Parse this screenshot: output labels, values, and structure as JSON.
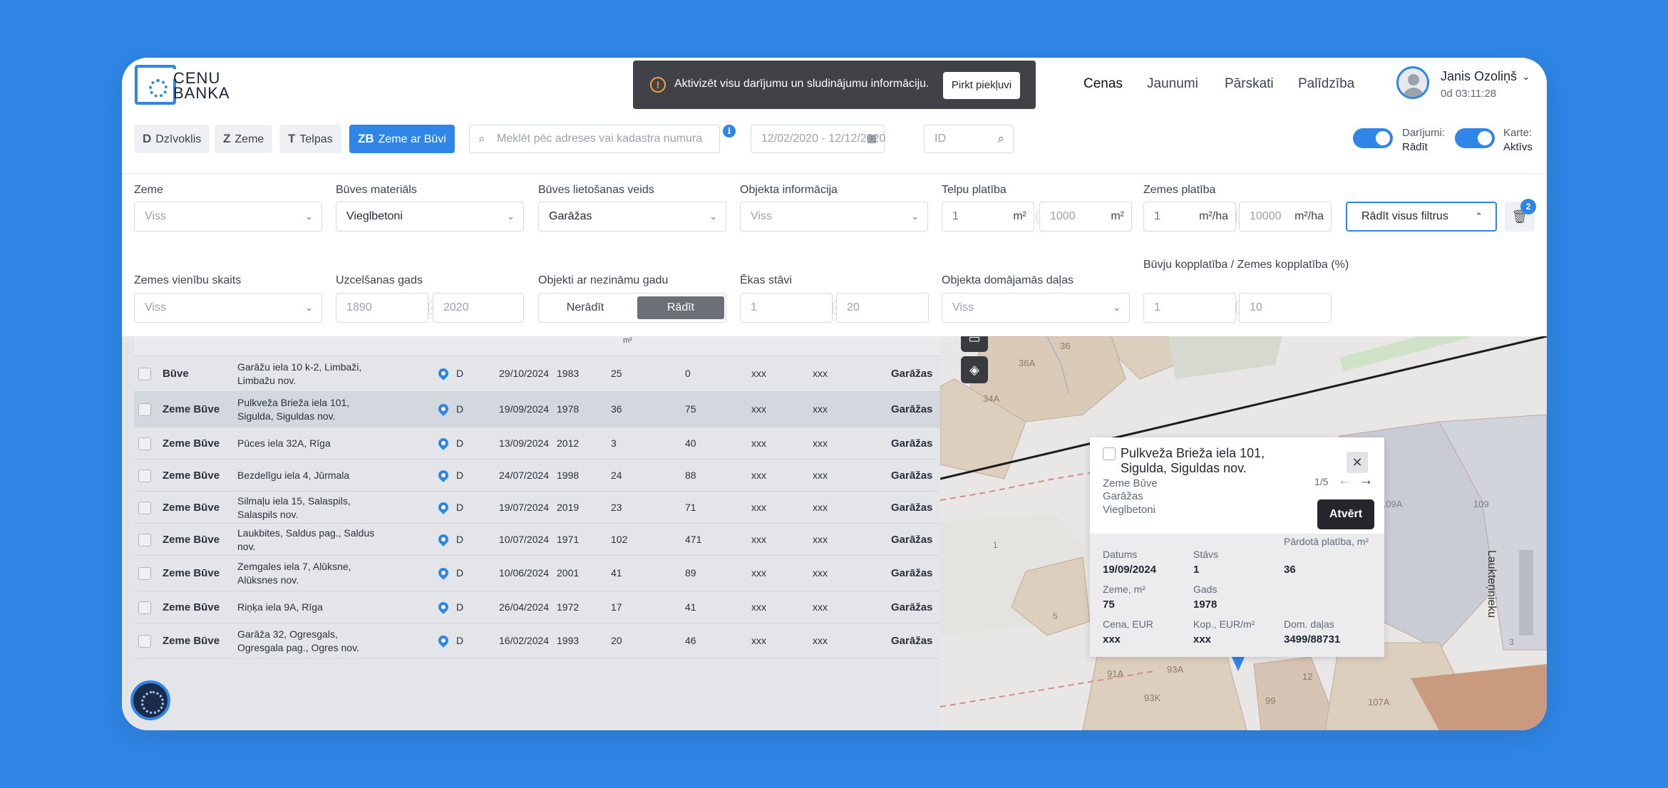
{
  "app": {
    "logo_text": "CENU\nBANKA"
  },
  "banner": {
    "message": "Aktivizēt visu darījumu un sludinājumu informāciju.",
    "button": "Pirkt piekļuvi"
  },
  "nav": [
    {
      "label": "Cenas",
      "active": true
    },
    {
      "label": "Jaunumi",
      "active": false
    },
    {
      "label": "Pārskati",
      "active": false
    },
    {
      "label": "Palīdzība",
      "active": false
    }
  ],
  "user": {
    "name": "Janis Ozoliņš",
    "time": "0d 03:11:28"
  },
  "tabs": [
    {
      "letter": "D",
      "label": "Dzīvoklis"
    },
    {
      "letter": "Z",
      "label": "Zeme"
    },
    {
      "letter": "T",
      "label": "Telpas"
    },
    {
      "letter": "ZB",
      "label": "Zeme ar Būvi"
    }
  ],
  "search": {
    "placeholder": "Meklēt pēc adreses vai kadastra numura",
    "info": "i",
    "date_range": "12/02/2020 - 12/12/2020",
    "id_placeholder": "ID"
  },
  "toggles": {
    "deals_label": "Darījumi:",
    "deals_value": "Rādīt",
    "map_label": "Karte:",
    "map_value": "Aktīvs"
  },
  "filters": {
    "zeme": {
      "label": "Zeme",
      "value": "Viss"
    },
    "material": {
      "label": "Būves materiāls",
      "value": "Vieglbetoni"
    },
    "usage": {
      "label": "Būves lietošanas veids",
      "value": "Garāžas"
    },
    "objinfo": {
      "label": "Objekta informācija",
      "value": "Viss"
    },
    "area": {
      "label": "Telpu platība",
      "from": "1",
      "to": "1000",
      "unit": "m²"
    },
    "land": {
      "label": "Zemes platība",
      "from": "1",
      "to": "10000",
      "unit": "m²/ha"
    },
    "units": {
      "label": "Zemes vienību skaits",
      "value": "Viss"
    },
    "year": {
      "label": "Uzcelšanas gads",
      "from": "1890",
      "to": "2020"
    },
    "unknown": {
      "label": "Objekti ar nezināmu gadu",
      "off": "Nerādīt",
      "on": "Rādīt"
    },
    "floors": {
      "label": "Ēkas stāvi",
      "from": "1",
      "to": "20"
    },
    "shares": {
      "label": "Objekta domājamās daļas",
      "value": "Viss"
    },
    "ratio": {
      "label": "Būvju kopplatība / Zemes kopplatība (%)",
      "from": "1",
      "to": "10"
    },
    "show_all": "Rādīt visus filtrus",
    "count": "2",
    "dash": "–"
  },
  "table": {
    "unit_header": "m²",
    "rows": [
      {
        "type": "Būve",
        "addr": "Garāžu iela 10 k-2, Limbaži, Limbažu nov.",
        "src": "D",
        "date": "29/10/2024",
        "year": "1983",
        "area": "25",
        "land": "0",
        "price": "xxx",
        "ppm": "xxx",
        "use": "Garāžas"
      },
      {
        "type": "Zeme Būve",
        "addr": "Pulkveža Brieža iela 101, Sigulda, Siguldas nov.",
        "src": "D",
        "date": "19/09/2024",
        "year": "1978",
        "area": "36",
        "land": "75",
        "price": "xxx",
        "ppm": "xxx",
        "use": "Garāžas"
      },
      {
        "type": "Zeme Būve",
        "addr": "Pūces iela 32A, Rīga",
        "src": "D",
        "date": "13/09/2024",
        "year": "2012",
        "area": "3",
        "land": "40",
        "price": "xxx",
        "ppm": "xxx",
        "use": "Garāžas"
      },
      {
        "type": "Zeme Būve",
        "addr": "Bezdelīgu iela 4, Jūrmala",
        "src": "D",
        "date": "24/07/2024",
        "year": "1998",
        "area": "24",
        "land": "88",
        "price": "xxx",
        "ppm": "xxx",
        "use": "Garāžas"
      },
      {
        "type": "Zeme Būve",
        "addr": "Silmaļu iela 15, Salaspils, Salaspils nov.",
        "src": "D",
        "date": "19/07/2024",
        "year": "2019",
        "area": "23",
        "land": "71",
        "price": "xxx",
        "ppm": "xxx",
        "use": "Garāžas"
      },
      {
        "type": "Zeme Būve",
        "addr": "Laukbites, Saldus pag., Saldus nov.",
        "src": "D",
        "date": "10/07/2024",
        "year": "1971",
        "area": "102",
        "land": "471",
        "price": "xxx",
        "ppm": "xxx",
        "use": "Garāžas"
      },
      {
        "type": "Zeme Būve",
        "addr": "Zemgales iela 7, Alūksne, Alūksnes nov.",
        "src": "D",
        "date": "10/06/2024",
        "year": "2001",
        "area": "41",
        "land": "89",
        "price": "xxx",
        "ppm": "xxx",
        "use": "Garāžas"
      },
      {
        "type": "Zeme Būve",
        "addr": "Riņķa iela 9A, Rīga",
        "src": "D",
        "date": "26/04/2024",
        "year": "1972",
        "area": "17",
        "land": "41",
        "price": "xxx",
        "ppm": "xxx",
        "use": "Garāžas"
      },
      {
        "type": "Zeme Būve",
        "addr": "Garāža 32, Ogresgals, Ogresgala pag., Ogres nov.",
        "src": "D",
        "date": "16/02/2024",
        "year": "1993",
        "area": "20",
        "land": "46",
        "price": "xxx",
        "ppm": "xxx",
        "use": "Garāžas"
      }
    ]
  },
  "map": {
    "labels": [
      "36",
      "36A",
      "34A",
      "109A",
      "109",
      "1",
      "5",
      "3",
      "91A",
      "93A",
      "93K",
      "99",
      "107A",
      "12",
      "Laukteņniekи"
    ],
    "popup": {
      "title": "Pulkveža Brieža iela 101, Sigulda, Siguldas nov.",
      "type": "Zeme Būve",
      "use": "Garāžas",
      "material": "Vieglbetoni",
      "pager": "1/5",
      "open": "Atvērt",
      "close": "✕",
      "fields": [
        {
          "label": "Datums",
          "value": "19/09/2024"
        },
        {
          "label": "Stāvs",
          "value": "1"
        },
        {
          "label": "Pārdotā platība, m²",
          "value": "36"
        },
        {
          "label": "Zeme, m²",
          "value": "75"
        },
        {
          "label": "Gads",
          "value": "1978"
        },
        {
          "label": "Cena, EUR",
          "value": "xxx"
        },
        {
          "label": "Kop., EUR/m²",
          "value": "xxx"
        },
        {
          "label": "Dom. daļas",
          "value": "3499/88731"
        }
      ]
    }
  },
  "colors": {
    "accent": "#2f86e6",
    "banner": "#414247",
    "map_bg": "#e8e7e6",
    "building": "#d8c9b6",
    "road_red": "#d88a8a"
  }
}
